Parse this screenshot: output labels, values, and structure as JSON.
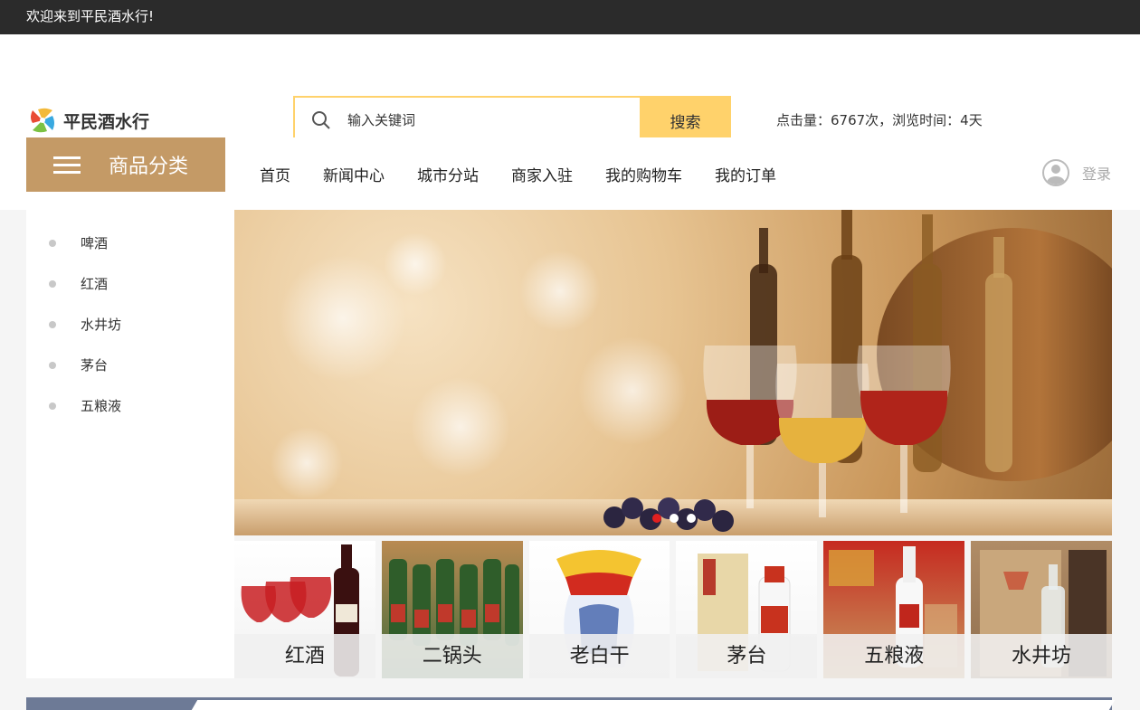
{
  "topbar": {
    "welcome": "欢迎来到平民酒水行!"
  },
  "header": {
    "logo_text": "平民酒水行",
    "search": {
      "placeholder": "输入关键词",
      "button_label": "搜索"
    },
    "stats": "点击量：6767次，浏览时间：4天"
  },
  "nav": {
    "category_label": "商品分类",
    "links": [
      "首页",
      "新闻中心",
      "城市分站",
      "商家入驻",
      "我的购物车",
      "我的订单"
    ],
    "login_label": "登录"
  },
  "sidebar": {
    "items": [
      "啤酒",
      "红酒",
      "水井坊",
      "茅台",
      "五粮液"
    ]
  },
  "banner": {
    "slide_count": 3,
    "active_slide": 1
  },
  "products": [
    "红酒",
    "二锅头",
    "老白干",
    "茅台",
    "五粮液",
    "水井坊"
  ],
  "colors": {
    "accent": "#ffd26b",
    "category": "#c49a66",
    "topbar": "#2b2b2b"
  }
}
